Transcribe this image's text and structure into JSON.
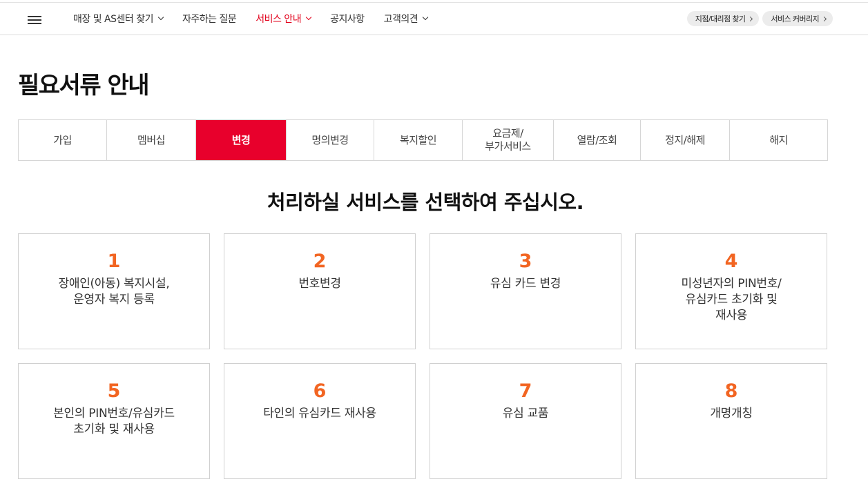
{
  "header": {
    "nav": [
      {
        "label": "매장 및 AS센터 찾기",
        "dropdown": true,
        "active": false
      },
      {
        "label": "자주하는 질문",
        "dropdown": false,
        "active": false
      },
      {
        "label": "서비스 안내",
        "dropdown": true,
        "active": true
      },
      {
        "label": "공지사항",
        "dropdown": false,
        "active": false
      },
      {
        "label": "고객의견",
        "dropdown": true,
        "active": false
      }
    ],
    "quick_links": [
      "지점/대리점 찾기",
      "서비스 커버리지"
    ]
  },
  "page_title": "필요서류 안내",
  "tabs": [
    {
      "label": "가입",
      "active": false
    },
    {
      "label": "멤버십",
      "active": false
    },
    {
      "label": "변경",
      "active": true
    },
    {
      "label": "명의변경",
      "active": false
    },
    {
      "label": "복지할인",
      "active": false
    },
    {
      "label": "요금제/\n부가서비스",
      "active": false
    },
    {
      "label": "열람/조회",
      "active": false
    },
    {
      "label": "정지/해제",
      "active": false
    },
    {
      "label": "해지",
      "active": false
    }
  ],
  "subtitle": "처리하실 서비스를 선택하여 주십시오.",
  "cards": [
    {
      "number": "1",
      "label": "장애인(아동) 복지시설,\n운영자 복지 등록"
    },
    {
      "number": "2",
      "label": "번호변경"
    },
    {
      "number": "3",
      "label": "유심 카드 변경"
    },
    {
      "number": "4",
      "label": "미성년자의 PIN번호/\n유심카드 초기화 및\n재사용"
    },
    {
      "number": "5",
      "label": "본인의 PIN번호/유심카드\n초기화 및 재사용"
    },
    {
      "number": "6",
      "label": "타인의 유심카드 재사용"
    },
    {
      "number": "7",
      "label": "유심 교품"
    },
    {
      "number": "8",
      "label": "개명개칭"
    }
  ],
  "colors": {
    "accent": "#e8002c",
    "nav_active": "#e2001a",
    "number": "#f26522"
  },
  "icons": {
    "menu": "hamburger-icon",
    "dropdown": "chevron-down-icon",
    "link": "chevron-right-icon"
  }
}
